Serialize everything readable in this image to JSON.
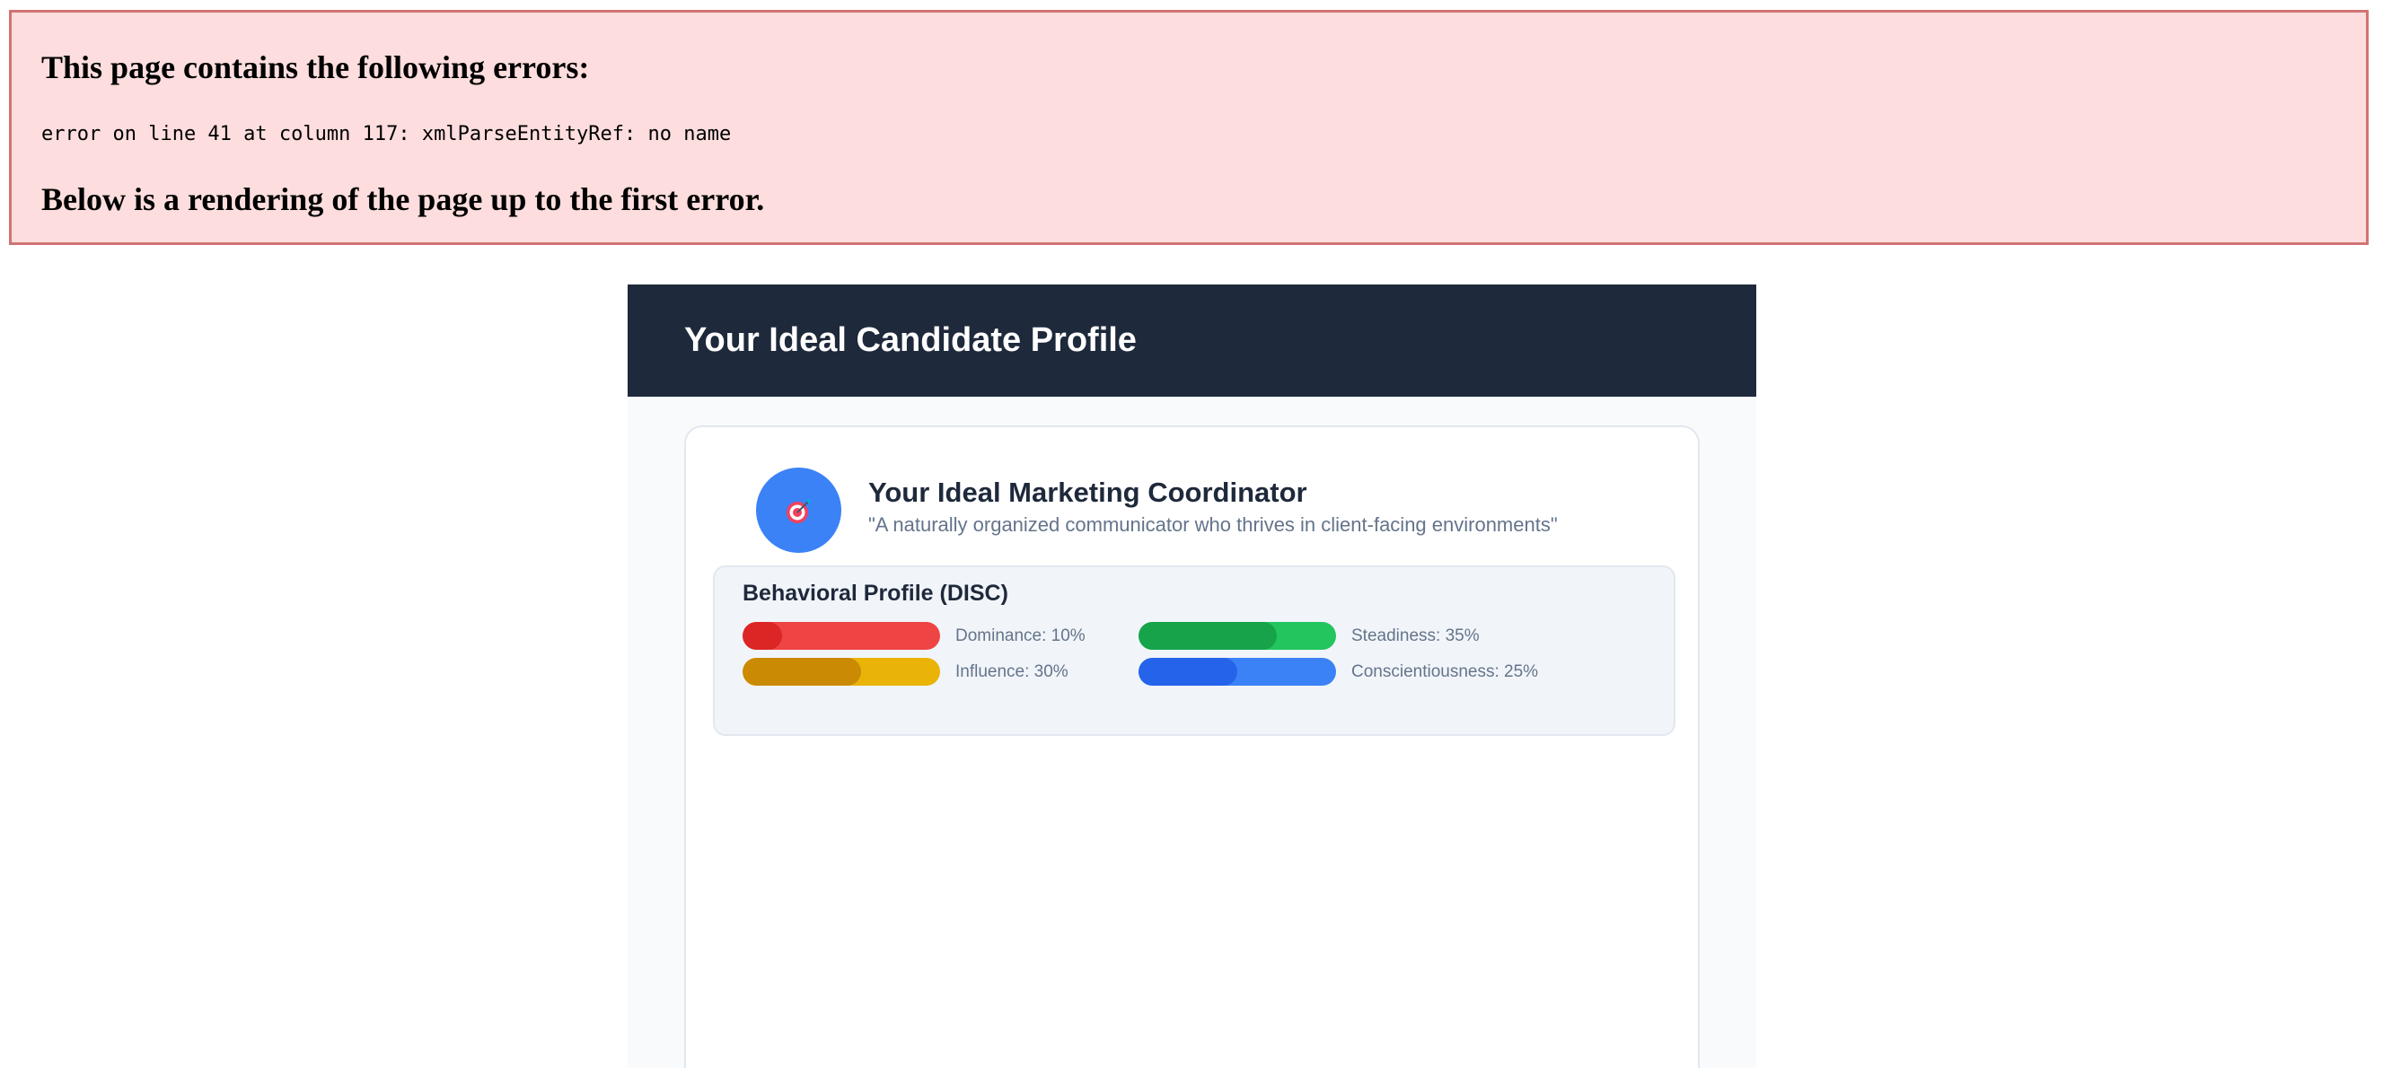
{
  "error": {
    "title": "This page contains the following errors:",
    "message": "error on line 41 at column 117: xmlParseEntityRef: no name",
    "subtitle": "Below is a rendering of the page up to the first error."
  },
  "header": {
    "title": "Your Ideal Candidate Profile"
  },
  "profile": {
    "avatar_icon": "target-icon",
    "avatar_glyph": "🎯",
    "name": "Your Ideal Marketing Coordinator",
    "tagline": "\"A naturally organized communicator who thrives in client-facing environments\""
  },
  "disc": {
    "title": "Behavioral Profile (DISC)",
    "traits": [
      {
        "label": "Dominance: 10%",
        "value": 0.2,
        "track_color": "#ef4444",
        "fill_color": "#dc2626"
      },
      {
        "label": "Steadiness: 35%",
        "value": 0.7,
        "track_color": "#22c55e",
        "fill_color": "#16a34a"
      },
      {
        "label": "Influence: 30%",
        "value": 0.6,
        "track_color": "#eab308",
        "fill_color": "#ca8a04"
      },
      {
        "label": "Conscientiousness: 25%",
        "value": 0.5,
        "track_color": "#3b82f6",
        "fill_color": "#2563eb"
      }
    ]
  }
}
